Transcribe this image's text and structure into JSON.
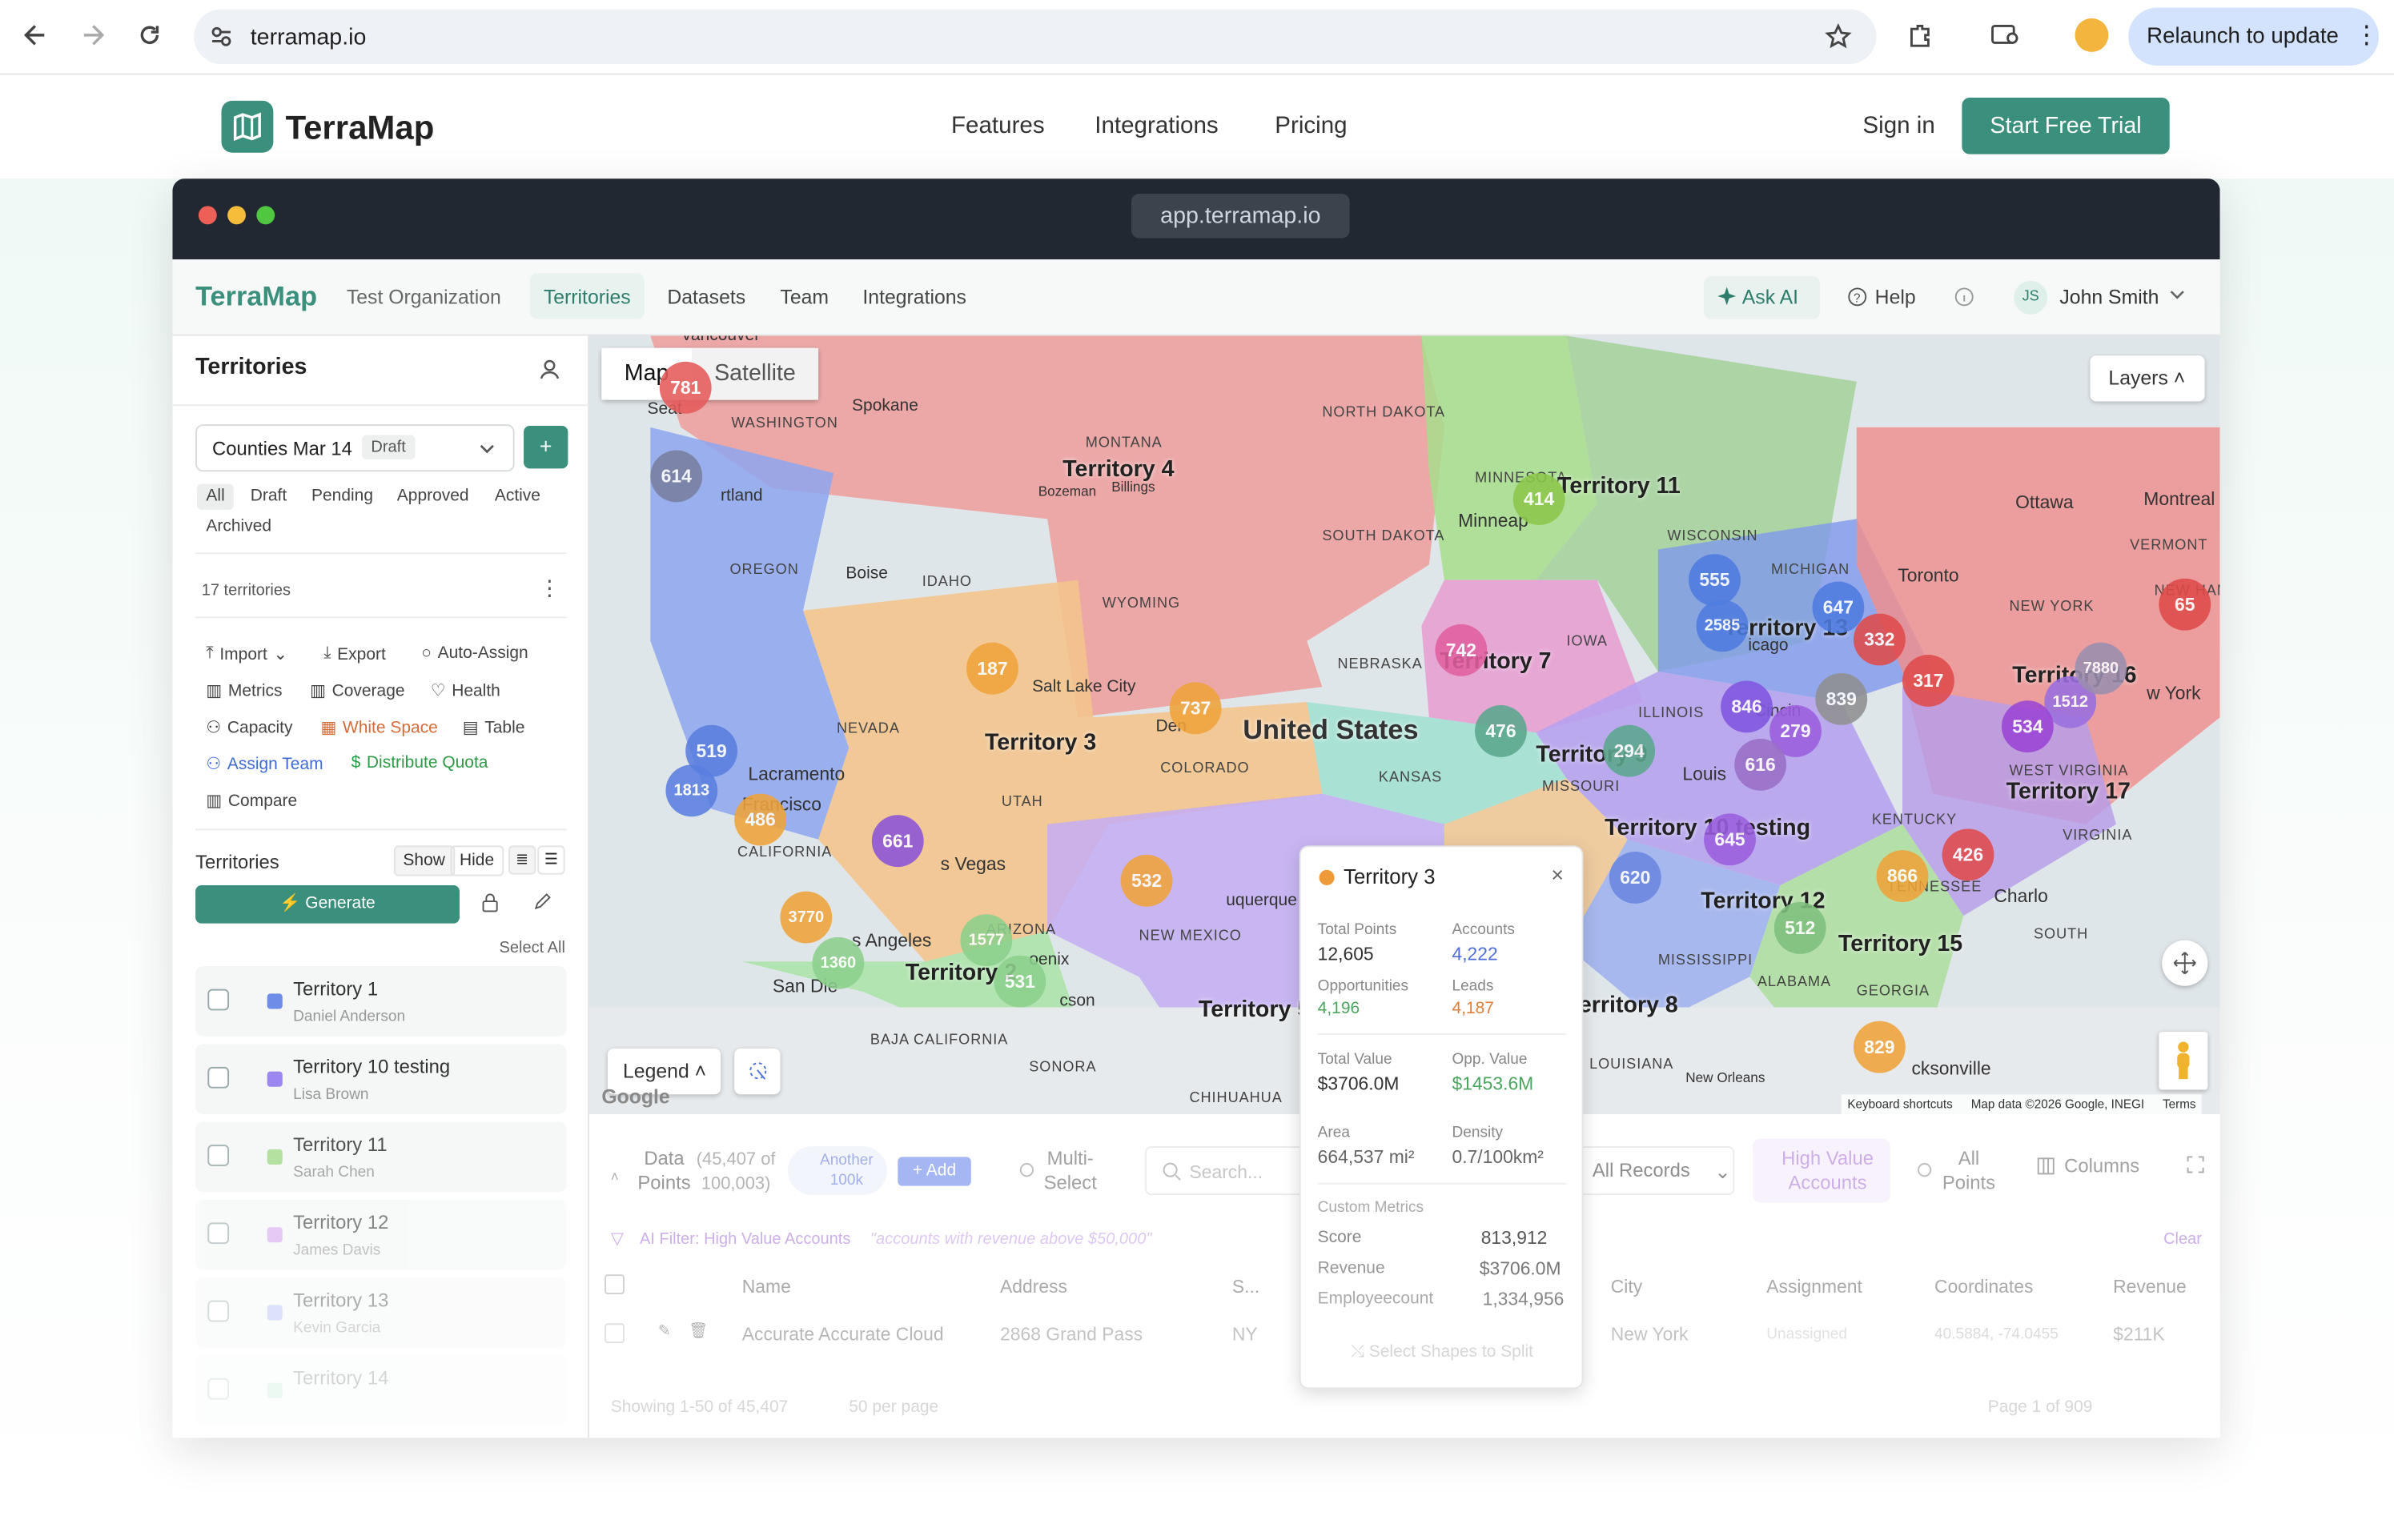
{
  "browser": {
    "url": "terramap.io",
    "relaunch": "Relaunch to update"
  },
  "site": {
    "brand": "TerraMap",
    "nav": [
      "Features",
      "Integrations",
      "Pricing"
    ],
    "signin": "Sign in",
    "trial": "Start Free Trial"
  },
  "window": {
    "url": "app.terramap.io"
  },
  "app": {
    "brand": "TerraMap",
    "org": "Test Organization",
    "nav": [
      "Territories",
      "Datasets",
      "Team",
      "Integrations"
    ],
    "ask_ai": "Ask AI",
    "help": "Help",
    "user_initials": "JS",
    "user": "John Smith"
  },
  "sidebar": {
    "title": "Territories",
    "version": "Counties Mar 14",
    "version_badge": "Draft",
    "filters": [
      "All",
      "Draft",
      "Pending",
      "Approved",
      "Active",
      "Archived"
    ],
    "count": "17 territories",
    "tools": [
      "Import",
      "Export",
      "Auto-Assign",
      "Metrics",
      "Coverage",
      "Health",
      "Capacity",
      "White Space",
      "Table",
      "Assign Team",
      "Distribute Quota",
      "Compare"
    ],
    "list_title": "Territories",
    "show": "Show",
    "hide": "Hide",
    "generate": "Generate",
    "select_all": "Select All",
    "items": [
      {
        "name": "Territory 1",
        "owner": "Daniel Anderson",
        "color": "#6e8de8"
      },
      {
        "name": "Territory 10 testing",
        "owner": "Lisa Brown",
        "color": "#9b87ef"
      },
      {
        "name": "Territory 11",
        "owner": "Sarah Chen",
        "color": "#a7dc8f"
      },
      {
        "name": "Territory 12",
        "owner": "James Davis",
        "color": "#d7a8ef"
      },
      {
        "name": "Territory 13",
        "owner": "Kevin Garcia",
        "color": "#a7b8f3"
      },
      {
        "name": "Territory 14",
        "owner": "",
        "color": "#a6e3c0"
      }
    ]
  },
  "map": {
    "tabs": [
      "Map",
      "Satellite"
    ],
    "layers": "Layers",
    "legend": "Legend",
    "country": "United States",
    "attribution": "Keyboard shortcuts",
    "mapdata": "Map data ©2026 Google, INEGI",
    "terms": "Terms",
    "google": "Google",
    "territories": [
      "Territory 4",
      "Territory 11",
      "Territory 13",
      "Territory 16",
      "Territory 7",
      "Territory 3",
      "Territory 9",
      "Territory 17",
      "Territory 10 testing",
      "Territory 12",
      "Territory 15",
      "Territory 2",
      "Territory 5",
      "Territory 8"
    ],
    "states": [
      "WASHINGTON",
      "MONTANA",
      "NORTH DAKOTA",
      "MINNESOTA",
      "SOUTH DAKOTA",
      "WISCONSIN",
      "MICHIGAN",
      "OREGON",
      "IDAHO",
      "WYOMING",
      "IOWA",
      "NEBRASKA",
      "NEVADA",
      "ILLINOIS",
      "UTAH",
      "COLORADO",
      "KANSAS",
      "MISSOURI",
      "KENTUCKY",
      "WEST VIRGINIA",
      "VIRGINIA",
      "CALIFORNIA",
      "ARIZONA",
      "NEW MEXICO",
      "TENNESSEE",
      "MISSISSIPPI",
      "ALABAMA",
      "GEORGIA",
      "SOUTH",
      "NEW YORK",
      "VERMONT",
      "NEW HAMPSH",
      "BAJA CALIFORNIA",
      "SONORA",
      "CHIHUAHUA",
      "LOUISIANA"
    ],
    "cities": [
      "Vancouver",
      "Seat",
      "Spokane",
      "rtland",
      "Bozeman",
      "Billings",
      "Minneap",
      "Ottawa",
      "Montreal",
      "Toronto",
      "Boise",
      "Salt Lake City",
      "Den",
      "Lacramento",
      "Francisco",
      "s Vegas",
      "s Angeles",
      "San Die",
      "oenix",
      "cson",
      "uquerque",
      "Louis",
      "Cincin",
      "icago",
      "Charlo",
      "cksonville",
      "New Orleans",
      "w York"
    ],
    "clusters": [
      "781",
      "614",
      "414",
      "555",
      "2585",
      "647",
      "332",
      "317",
      "1512",
      "7880",
      "534",
      "65",
      "742",
      "187",
      "737",
      "476",
      "294",
      "846",
      "279",
      "839",
      "616",
      "519",
      "1813",
      "486",
      "661",
      "645",
      "620",
      "426",
      "866",
      "512",
      "532",
      "3770",
      "1577",
      "1360",
      "531",
      "829"
    ]
  },
  "table": {
    "data_points": "Data Points",
    "count": "(45,407 of 100,003)",
    "another": "Another 100k",
    "add": "Add",
    "multi": "Multi-Select",
    "search": "Search...",
    "records": "All Records",
    "hva": "High Value Accounts",
    "allpoints": "All Points",
    "columns": "Columns",
    "ai_filter": "AI Filter: High Value Accounts",
    "ai_query": "\"accounts with revenue above $50,000\"",
    "clear": "Clear",
    "headers": [
      "Name",
      "Address",
      "S...",
      "City",
      "Assignment",
      "Coordinates",
      "Revenue"
    ],
    "row": [
      "Accurate Accurate Cloud",
      "2868 Grand Pass",
      "NY",
      "New York",
      "Unassigned",
      "40.5884, -74.0455",
      "$211K"
    ],
    "footer": "Showing 1-50 of 45,407",
    "perpage": "50 per page",
    "page": "Page 1 of 909"
  },
  "popup": {
    "title": "Territory 3",
    "k1": "Total Points",
    "v1": "12,605",
    "k2": "Accounts",
    "v2": "4,222",
    "k3": "Opportunities",
    "v3": "4,196",
    "k4": "Leads",
    "v4": "4,187",
    "k5": "Total Value",
    "v5": "$3706.0M",
    "k6": "Opp. Value",
    "v6": "$1453.6M",
    "k7": "Area",
    "v7": "664,537 mi²",
    "k8": "Density",
    "v8": "0.7/100km²",
    "custom": "Custom Metrics",
    "m1": "Score",
    "m1v": "813,912",
    "m2": "Revenue",
    "m2v": "$3706.0M",
    "m3": "Employeecount",
    "m3v": "1,334,956",
    "split": "Select Shapes to Split"
  }
}
